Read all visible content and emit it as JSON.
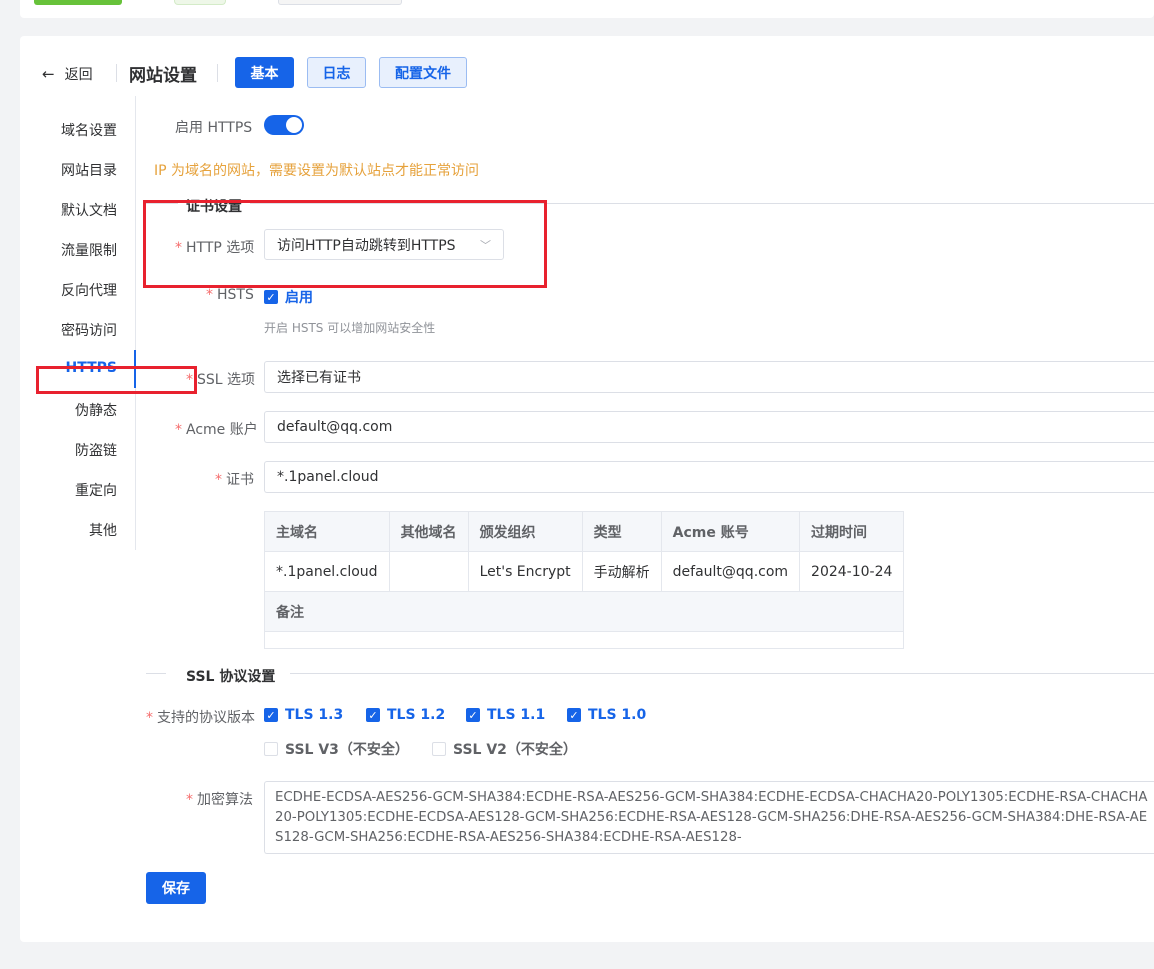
{
  "header": {
    "back_label": "返回",
    "title": "网站设置",
    "tabs": {
      "basic": "基本",
      "log": "日志",
      "config": "配置文件"
    }
  },
  "side_nav": {
    "items": [
      "域名设置",
      "网站目录",
      "默认文档",
      "流量限制",
      "反向代理",
      "密码访问",
      "HTTPS",
      "伪静态",
      "防盗链",
      "重定向",
      "其他"
    ],
    "active": "HTTPS"
  },
  "https": {
    "enable_label": "启用 HTTPS",
    "enabled": true,
    "warning": "IP 为域名的网站，需要设置为默认站点才能正常访问"
  },
  "cert_section": {
    "title": "证书设置",
    "http_option_label": "HTTP 选项",
    "http_option_value": "访问HTTP自动跳转到HTTPS",
    "hsts_label": "HSTS",
    "hsts_checkbox": "启用",
    "hsts_hint": "开启 HSTS 可以增加网站安全性",
    "ssl_option_label": "SSL 选项",
    "ssl_option_value": "选择已有证书",
    "acme_label": "Acme 账户",
    "acme_value": "default@qq.com",
    "cert_label": "证书",
    "cert_value": "*.1panel.cloud"
  },
  "cert_table": {
    "headers": [
      "主域名",
      "其他域名",
      "颁发组织",
      "类型",
      "Acme 账号",
      "过期时间"
    ],
    "row": [
      "*.1panel.cloud",
      "",
      "Let's Encrypt",
      "手动解析",
      "default@qq.com",
      "2024-10-24"
    ],
    "note_label": "备注"
  },
  "ssl_protocol": {
    "title": "SSL 协议设置",
    "versions_label": "支持的协议版本",
    "versions": [
      {
        "label": "TLS 1.3",
        "checked": true
      },
      {
        "label": "TLS 1.2",
        "checked": true
      },
      {
        "label": "TLS 1.1",
        "checked": true
      },
      {
        "label": "TLS 1.0",
        "checked": true
      },
      {
        "label": "SSL V3（不安全）",
        "checked": false
      },
      {
        "label": "SSL V2（不安全）",
        "checked": false
      }
    ],
    "cipher_label": "加密算法",
    "cipher_value": "ECDHE-ECDSA-AES256-GCM-SHA384:ECDHE-RSA-AES256-GCM-SHA384:ECDHE-ECDSA-CHACHA20-POLY1305:ECDHE-RSA-CHACHA20-POLY1305:ECDHE-ECDSA-AES128-GCM-SHA256:ECDHE-RSA-AES128-GCM-SHA256:DHE-RSA-AES256-GCM-SHA384:DHE-RSA-AES128-GCM-SHA256:ECDHE-RSA-AES256-SHA384:ECDHE-RSA-AES128-"
  },
  "save_label": "保存",
  "colors": {
    "primary": "#1664e8",
    "warning": "#e6a23c",
    "annotation": "#e8212e"
  }
}
